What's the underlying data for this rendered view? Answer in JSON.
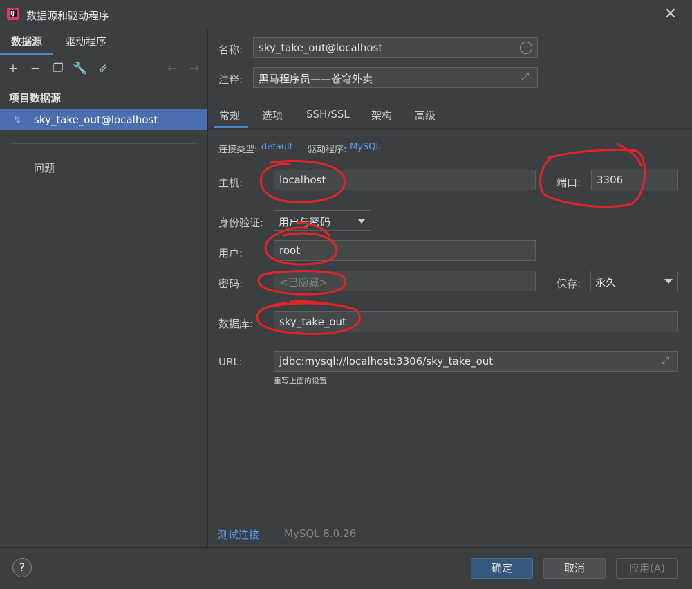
{
  "window": {
    "title": "数据源和驱动程序",
    "app_icon_text": "IJ",
    "close_glyph": "✕"
  },
  "sidebar": {
    "tabs": [
      "数据源",
      "驱动程序"
    ],
    "section_title": "项目数据源",
    "selected_source": "sky_take_out@localhost",
    "problems_label": "问题"
  },
  "form": {
    "name_label": "名称:",
    "name_value": "sky_take_out@localhost",
    "comment_label": "注释:",
    "comment_value": "黑马程序员——苍穹外卖",
    "tabs": [
      "常规",
      "选项",
      "SSH/SSL",
      "架构",
      "高级"
    ],
    "conn_type_label": "连接类型:",
    "conn_type_value": "default",
    "driver_label": "驱动程序:",
    "driver_value": "MySQL",
    "host_label": "主机:",
    "host_value": "localhost",
    "port_label": "端口:",
    "port_value": "3306",
    "auth_label": "身份验证:",
    "auth_value": "用户与密码",
    "user_label": "用户:",
    "user_value": "root",
    "password_label": "密码:",
    "password_placeholder": "<已隐藏>",
    "save_label": "保存:",
    "save_value": "永久",
    "database_label": "数据库:",
    "database_value": "sky_take_out",
    "url_label": "URL:",
    "url_value": "jdbc:mysql://localhost:3306/sky_take_out",
    "url_hint": "重写上面的设置"
  },
  "bottom": {
    "test_connection": "测试连接",
    "driver_version": "MySQL 8.0.26"
  },
  "footer": {
    "help_glyph": "?",
    "ok": "确定",
    "cancel": "取消",
    "apply": "应用(A)"
  },
  "colors": {
    "accent": "#4a88c7",
    "selection": "#4b6eaf",
    "link": "#589df6",
    "annotation": "#e0242a"
  }
}
